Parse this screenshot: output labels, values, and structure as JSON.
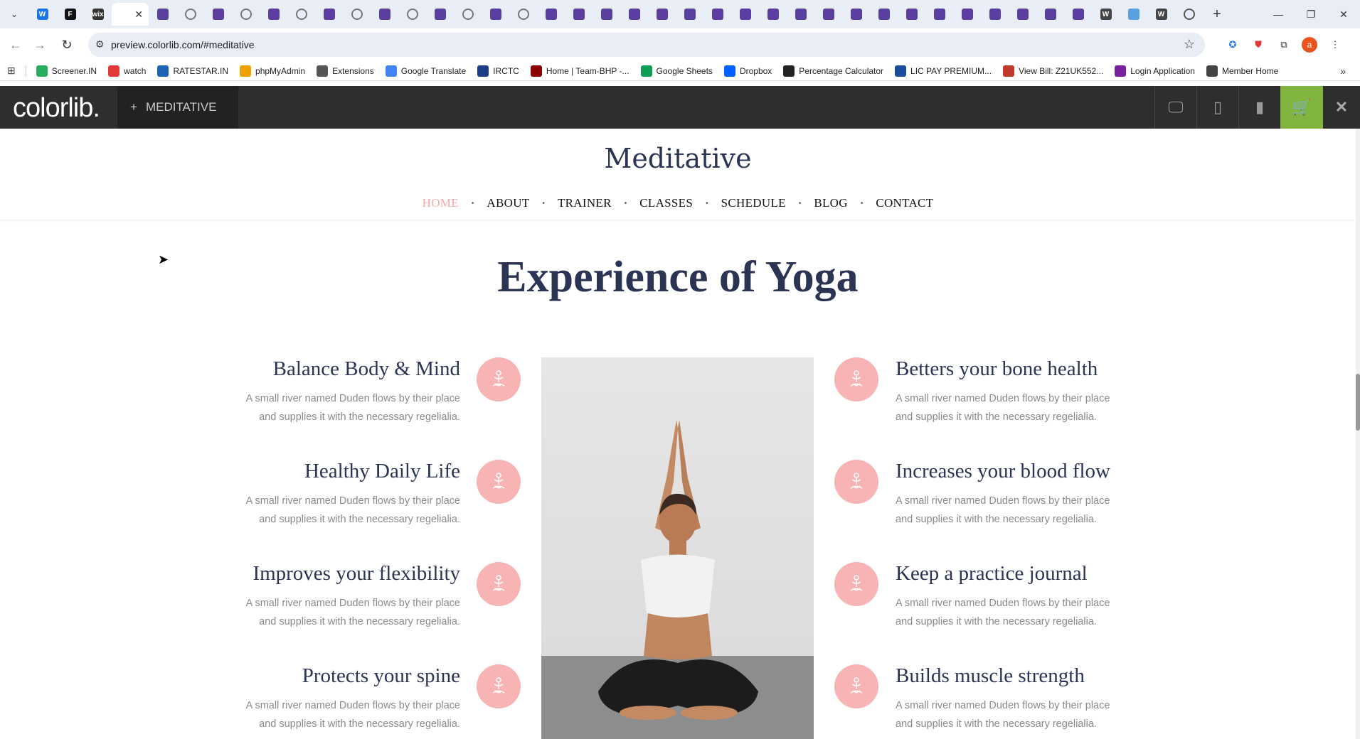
{
  "browser": {
    "tabs": [
      {
        "kind": "generic",
        "color": "#1a73e8",
        "glyph": "W"
      },
      {
        "kind": "generic",
        "color": "#111111",
        "glyph": "F"
      },
      {
        "kind": "generic",
        "color": "#333333",
        "glyph": "wix"
      },
      {
        "kind": "active",
        "color": "#e9eef6",
        "glyph": ""
      },
      {
        "kind": "colorlib",
        "color": "#5b3fa0",
        "glyph": ""
      },
      {
        "kind": "globe",
        "color": "#777777",
        "glyph": ""
      },
      {
        "kind": "colorlib",
        "color": "#5b3fa0",
        "glyph": ""
      },
      {
        "kind": "globe",
        "color": "#777777",
        "glyph": ""
      },
      {
        "kind": "colorlib",
        "color": "#5b3fa0",
        "glyph": ""
      },
      {
        "kind": "globe",
        "color": "#777777",
        "glyph": ""
      },
      {
        "kind": "colorlib",
        "color": "#5b3fa0",
        "glyph": ""
      },
      {
        "kind": "globe",
        "color": "#777777",
        "glyph": ""
      },
      {
        "kind": "colorlib",
        "color": "#5b3fa0",
        "glyph": ""
      },
      {
        "kind": "globe",
        "color": "#777777",
        "glyph": ""
      },
      {
        "kind": "colorlib",
        "color": "#5b3fa0",
        "glyph": ""
      },
      {
        "kind": "globe",
        "color": "#777777",
        "glyph": ""
      },
      {
        "kind": "colorlib",
        "color": "#5b3fa0",
        "glyph": ""
      },
      {
        "kind": "globe",
        "color": "#777777",
        "glyph": ""
      },
      {
        "kind": "colorlib",
        "color": "#5b3fa0",
        "glyph": ""
      },
      {
        "kind": "colorlib",
        "color": "#5b3fa0",
        "glyph": ""
      },
      {
        "kind": "colorlib",
        "color": "#5b3fa0",
        "glyph": ""
      },
      {
        "kind": "colorlib",
        "color": "#5b3fa0",
        "glyph": ""
      },
      {
        "kind": "colorlib",
        "color": "#5b3fa0",
        "glyph": ""
      },
      {
        "kind": "colorlib",
        "color": "#5b3fa0",
        "glyph": ""
      },
      {
        "kind": "colorlib",
        "color": "#5b3fa0",
        "glyph": ""
      },
      {
        "kind": "colorlib",
        "color": "#5b3fa0",
        "glyph": ""
      },
      {
        "kind": "colorlib",
        "color": "#5b3fa0",
        "glyph": ""
      },
      {
        "kind": "colorlib",
        "color": "#5b3fa0",
        "glyph": ""
      },
      {
        "kind": "colorlib",
        "color": "#5b3fa0",
        "glyph": ""
      },
      {
        "kind": "colorlib",
        "color": "#5b3fa0",
        "glyph": ""
      },
      {
        "kind": "colorlib",
        "color": "#5b3fa0",
        "glyph": ""
      },
      {
        "kind": "colorlib",
        "color": "#5b3fa0",
        "glyph": ""
      },
      {
        "kind": "colorlib",
        "color": "#5b3fa0",
        "glyph": ""
      },
      {
        "kind": "colorlib",
        "color": "#5b3fa0",
        "glyph": ""
      },
      {
        "kind": "colorlib",
        "color": "#5b3fa0",
        "glyph": ""
      },
      {
        "kind": "colorlib",
        "color": "#5b3fa0",
        "glyph": ""
      },
      {
        "kind": "colorlib",
        "color": "#5b3fa0",
        "glyph": ""
      },
      {
        "kind": "colorlib",
        "color": "#5b3fa0",
        "glyph": ""
      },
      {
        "kind": "generic",
        "color": "#444444",
        "glyph": "W"
      },
      {
        "kind": "generic",
        "color": "#5aa0e0",
        "glyph": ""
      },
      {
        "kind": "generic",
        "color": "#444444",
        "glyph": "W"
      },
      {
        "kind": "globe",
        "color": "#555555",
        "glyph": ""
      }
    ],
    "url": "preview.colorlib.com/#meditative",
    "profile_initial": "a",
    "bookmarks": [
      {
        "label": "Screener.IN",
        "color": "#27ae60"
      },
      {
        "label": "watch",
        "color": "#e53935"
      },
      {
        "label": "RATESTAR.IN",
        "color": "#1e63b5"
      },
      {
        "label": "phpMyAdmin",
        "color": "#f0a000"
      },
      {
        "label": "Extensions",
        "color": "#555555"
      },
      {
        "label": "Google Translate",
        "color": "#4285f4"
      },
      {
        "label": "IRCTC",
        "color": "#1d3c8a"
      },
      {
        "label": "Home | Team-BHP -...",
        "color": "#8b0000"
      },
      {
        "label": "Google Sheets",
        "color": "#0f9d58"
      },
      {
        "label": "Dropbox",
        "color": "#0061fe"
      },
      {
        "label": "Percentage Calculator",
        "color": "#222222"
      },
      {
        "label": "LIC PAY PREMIUM...",
        "color": "#1a4d9c"
      },
      {
        "label": "View Bill: Z21UK552...",
        "color": "#c0392b"
      },
      {
        "label": "Login Application",
        "color": "#7b1fa2"
      },
      {
        "label": "Member Home",
        "color": "#444444"
      }
    ]
  },
  "colorlib": {
    "logo": "colorlib.",
    "theme_label": "MEDITATIVE"
  },
  "site": {
    "brand": "Meditative",
    "nav": [
      "HOME",
      "ABOUT",
      "TRAINER",
      "CLASSES",
      "SCHEDULE",
      "BLOG",
      "CONTACT"
    ],
    "active_nav": "HOME",
    "accent_color": "#f8b4b4",
    "heading_color": "#2b3452"
  },
  "section": {
    "title": "Experience of Yoga",
    "left_features": [
      {
        "title": "Balance Body & Mind",
        "text": "A small river named Duden flows by their place and supplies it with the necessary regelialia."
      },
      {
        "title": "Healthy Daily Life",
        "text": "A small river named Duden flows by their place and supplies it with the necessary regelialia."
      },
      {
        "title": "Improves your flexibility",
        "text": "A small river named Duden flows by their place and supplies it with the necessary regelialia."
      },
      {
        "title": "Protects your spine",
        "text": "A small river named Duden flows by their place and supplies it with the necessary regelialia."
      }
    ],
    "right_features": [
      {
        "title": "Betters your bone health",
        "text": "A small river named Duden flows by their place and supplies it with the necessary regelialia."
      },
      {
        "title": "Increases your blood flow",
        "text": "A small river named Duden flows by their place and supplies it with the necessary regelialia."
      },
      {
        "title": "Keep a practice journal",
        "text": "A small river named Duden flows by their place and supplies it with the necessary regelialia."
      },
      {
        "title": "Builds muscle strength",
        "text": "A small river named Duden flows by their place and supplies it with the necessary regelialia."
      }
    ],
    "feature_icon": "meditation-icon"
  }
}
